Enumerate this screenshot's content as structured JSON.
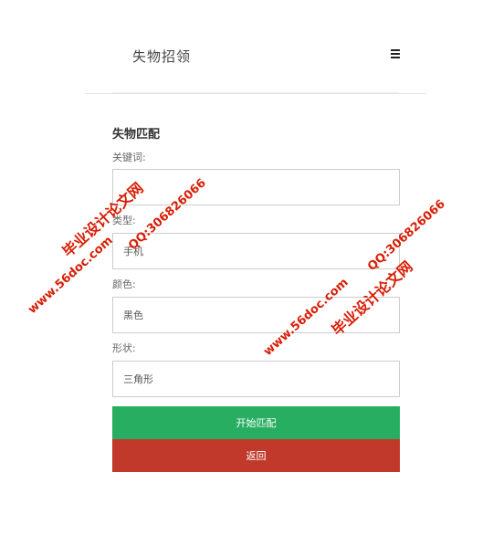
{
  "header": {
    "title": "失物招领",
    "menu_icon": "bars-icon"
  },
  "form": {
    "title": "失物匹配",
    "fields": [
      {
        "label": "关键词:",
        "value": "",
        "placeholder": ""
      },
      {
        "label": "类型:",
        "value": "手机",
        "placeholder": ""
      },
      {
        "label": "颜色:",
        "value": "黑色",
        "placeholder": ""
      },
      {
        "label": "形状:",
        "value": "三角形",
        "placeholder": ""
      }
    ],
    "start_button": "开始匹配",
    "back_button": "返回"
  },
  "colors": {
    "start": "#27ae60",
    "back": "#c0392b",
    "watermark": "#d81e06"
  },
  "watermarks": {
    "left_main": "毕业设计论文网",
    "left_qq": "QQ:306826066",
    "left_site": "www.56doc.com",
    "right_qq": "QQ:306826066",
    "right_site": "www.56doc.com",
    "right_main": "毕业设计论文网"
  }
}
